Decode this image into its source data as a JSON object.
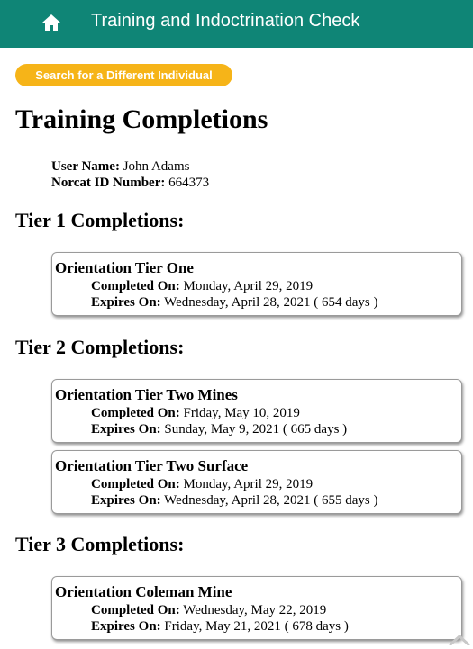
{
  "header": {
    "title": "Training and Indoctrination Check",
    "home_icon": "home-icon",
    "background": "#0f8576"
  },
  "search_button": {
    "label": "Search for a Different Individual",
    "color": "#f6b418"
  },
  "page_title": "Training Completions",
  "user": {
    "name_label": "User Name:",
    "name_value": "John Adams",
    "id_label": "Norcat ID Number:",
    "id_value": "664373"
  },
  "labels": {
    "completed_on": "Completed On:",
    "expires_on": "Expires On:"
  },
  "tiers": [
    {
      "heading": "Tier 1 Completions:",
      "courses": [
        {
          "title": "Orientation Tier One",
          "completed": "Monday, April 29, 2019",
          "expires": "Wednesday, April 28, 2021 ( 654 days )"
        }
      ]
    },
    {
      "heading": "Tier 2 Completions:",
      "courses": [
        {
          "title": "Orientation Tier Two Mines",
          "completed": "Friday, May 10, 2019",
          "expires": "Sunday, May 9, 2021 ( 665 days )"
        },
        {
          "title": "Orientation Tier Two Surface",
          "completed": "Monday, April 29, 2019",
          "expires": "Wednesday, April 28, 2021 ( 655 days )"
        }
      ]
    },
    {
      "heading": "Tier 3 Completions:",
      "courses": [
        {
          "title": "Orientation Coleman Mine",
          "completed": "Wednesday, May 22, 2019",
          "expires": "Friday, May 21, 2021 ( 678 days )"
        }
      ]
    }
  ]
}
